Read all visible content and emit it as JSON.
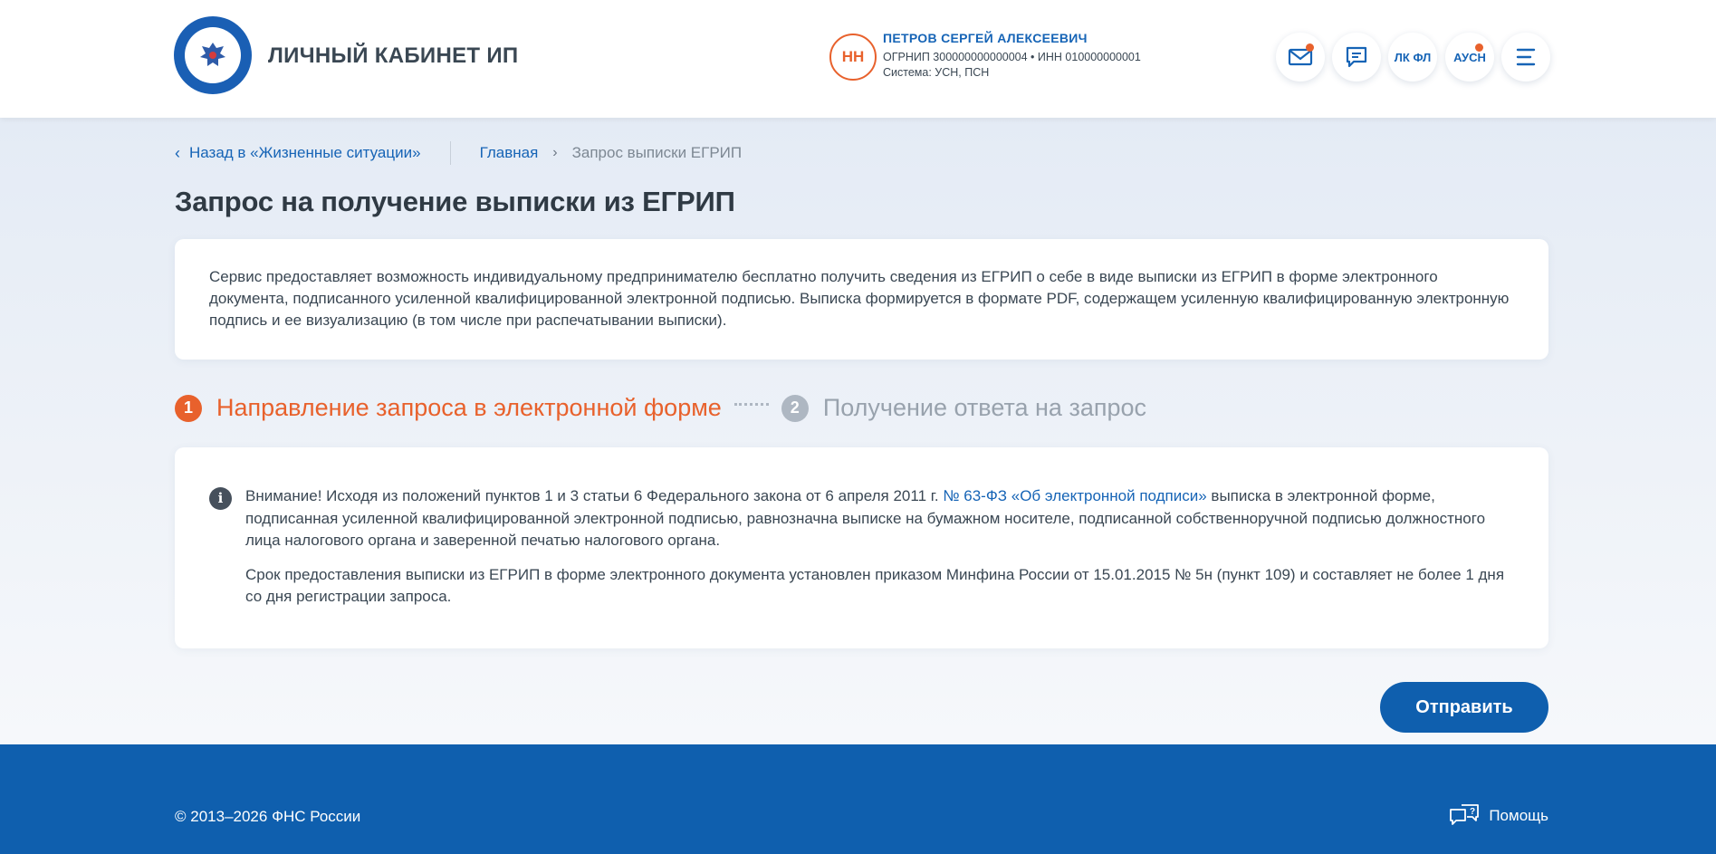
{
  "header": {
    "brand_title": "ЛИЧНЫЙ КАБИНЕТ ИП",
    "logo_icon": "eagle-emblem",
    "user": {
      "initials": "НН",
      "name": "ПЕТРОВ СЕРГЕЙ АЛЕКСЕЕВИЧ",
      "ids_line": "ОГРНИП 300000000000004 • ИНН 010000000001",
      "system_line": "Система: УСН, ПСН"
    },
    "buttons": {
      "mail_icon": "mail-icon",
      "chat_icon": "chat-icon",
      "lk_fl": "ЛК ФЛ",
      "ausn": "АУСН",
      "menu_icon": "menu-icon"
    }
  },
  "breadcrumbs": {
    "back": "Назад в «Жизненные ситуации»",
    "home": "Главная",
    "current": "Запрос выписки ЕГРИП"
  },
  "page": {
    "title": "Запрос на получение выписки из ЕГРИП",
    "description": "Сервис предоставляет возможность индивидуальному предпринимателю бесплатно получить сведения из ЕГРИП о себе в виде выписки из ЕГРИП в форме электронного документа, подписанного усиленной квалифицированной электронной подписью. Выписка формируется в формате PDF, содержащем усиленную квалифицированную электронную подпись и ее визуализацию (в том числе при распечатывании выписки)."
  },
  "steps": [
    {
      "number": "1",
      "label": "Направление запроса в электронной форме",
      "state": "active"
    },
    {
      "number": "2",
      "label": "Получение ответа на запрос",
      "state": "inactive"
    }
  ],
  "notice": {
    "p1_before": "Внимание! Исходя из положений пунктов 1 и 3 статьи 6 Федерального закона от 6 апреля 2011 г. ",
    "p1_link": "№ 63-ФЗ «Об электронной подписи»",
    "p1_after": " выписка в электронной форме, подписанная усиленной квалифицированной электронной подписью, равнозначна выписке на бумажном носителе, подписанной собственноручной подписью должностного лица налогового органа и заверенной печатью налогового органа.",
    "p2": "Срок предоставления выписки из ЕГРИП в форме электронного документа установлен приказом Минфина России от 15.01.2015 № 5н (пункт 109) и составляет не более 1 дня со дня регистрации запроса."
  },
  "actions": {
    "submit": "Отправить"
  },
  "footer": {
    "copyright": "© 2013–2026 ФНС России",
    "help": "Помощь"
  },
  "colors": {
    "primary": "#0f5fae",
    "link": "#1664b6",
    "accent": "#e8612c"
  }
}
